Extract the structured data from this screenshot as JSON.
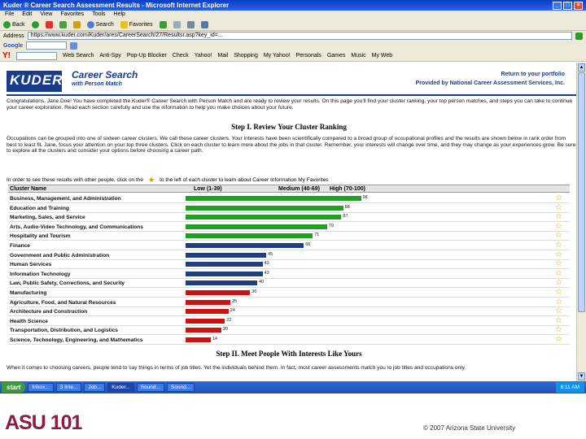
{
  "window": {
    "title": "Kuder ® Career Search Assessment Results - Microsoft Internet Explorer"
  },
  "menu": [
    "File",
    "Edit",
    "View",
    "Favorites",
    "Tools",
    "Help"
  ],
  "toolbar": {
    "back": "Back",
    "search": "Search",
    "favorites": "Favorites"
  },
  "address": {
    "label": "Address",
    "value": "https://www.kuder.com/Kuder/ares/CareerSearch/27/Resultsr.asp?key_id=..."
  },
  "links": {
    "label": "Google"
  },
  "ybar": {
    "logo": "Y!",
    "items": [
      "Web Search",
      "Anti-Spy",
      "Pop-Up Blocker",
      "Check",
      "Yahoo!",
      "Mail",
      "Shopping",
      "My Yahoo!",
      "Personals",
      "Games",
      "Music",
      "My Web"
    ]
  },
  "banner": {
    "logo": "KUDER®",
    "title": "Career Search",
    "subtitle": "with Person Match",
    "return_link": "Return to your portfolio",
    "provided_by": "Provided by National Career Assessment Services, Inc."
  },
  "intro": "Congratulations, Jane Doe! You have completed the Kuder® Career Search with Person Match and are ready to review your results. On this page you'll find your cluster ranking, your top person matches, and steps you can take to continue your career exploration. Read each section carefully and use the information to help you make choices about your future.",
  "step1": {
    "title": "Step I. Review Your Cluster Ranking",
    "text": "Occupations can be grouped into one of sixteen career clusters. We call these career clusters. Your interests have been scientifically compared to a broad group of occupational profiles and the results are shown below in rank order from best to least fit. Jane, focus your attention on your top three clusters. Click on each cluster to learn more about the jobs in that cluster. Remember, your interests will change over time, and they may change as your experiences grow. Be sure to explore all the clusters and consider your options before choosing a career path.",
    "compare_text": "In order to see these results with other people, click on the",
    "compare_text2": "to the left of each cluster to learn about Career Information My Favorites"
  },
  "table": {
    "col_cluster": "Cluster Name",
    "col_low": "Low (1-39)",
    "col_medium": "Medium (40-69)",
    "col_high": "High (70-100)"
  },
  "clusters": [
    {
      "name": "Business, Management, and Administration",
      "score": 98
    },
    {
      "name": "Education and Training",
      "score": 88
    },
    {
      "name": "Marketing, Sales, and Service",
      "score": 87
    },
    {
      "name": "Arts, Audio-Video Technology, and Communications",
      "score": 79
    },
    {
      "name": "Hospitality and Tourism",
      "score": 71
    },
    {
      "name": "Finance",
      "score": 66
    },
    {
      "name": "Government and Public Administration",
      "score": 45
    },
    {
      "name": "Human Services",
      "score": 43
    },
    {
      "name": "Information Technology",
      "score": 43
    },
    {
      "name": "Law, Public Safety, Corrections, and Security",
      "score": 40
    },
    {
      "name": "Manufacturing",
      "score": 36
    },
    {
      "name": "Agriculture, Food, and Natural Resources",
      "score": 25
    },
    {
      "name": "Architecture and Construction",
      "score": 24
    },
    {
      "name": "Health Science",
      "score": 22
    },
    {
      "name": "Transportation, Distribution, and Logistics",
      "score": 20
    },
    {
      "name": "Science, Technology, Engineering, and Mathematics",
      "score": 14
    }
  ],
  "colors": {
    "high": "#22a022",
    "medium": "#1f3f7f",
    "low": "#cc1111"
  },
  "step2": {
    "title": "Step II. Meet People With Interests Like Yours",
    "text": "When it comes to choosing careers, people tend to say things in terms of job titles. Yet the individuals behind them. In fact, most career assessments match you to job titles and occupations only."
  },
  "taskbar": {
    "start": "start",
    "items": [
      "Inbox...",
      "3 Inte...",
      "Job...",
      "Kuder...",
      "Sound...",
      "Sound..."
    ],
    "clock": "8:11 AM"
  },
  "footer": {
    "logo": "ASU 101",
    "copyright": "© 2007 Arizona State University"
  }
}
